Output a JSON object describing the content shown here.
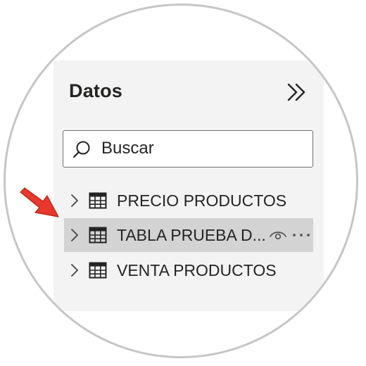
{
  "pane": {
    "title": "Datos"
  },
  "search": {
    "placeholder": "Buscar",
    "value": ""
  },
  "tables": [
    {
      "label": "PRECIO PRODUCTOS",
      "selected": false
    },
    {
      "label": "TABLA PRUEBA D...",
      "selected": true
    },
    {
      "label": "VENTA PRODUCTOS",
      "selected": false
    }
  ],
  "icons": {
    "collapse": "double-chevron-right-icon",
    "search": "search-icon",
    "expand": "chevron-right-icon",
    "table": "table-icon",
    "visibility": "eye-icon",
    "more": "more-options-icon",
    "annotation": "red-arrow-icon"
  },
  "colors": {
    "pane_background": "#f3f3f3",
    "selected_row": "#d3d3d3",
    "text": "#252423",
    "annotation_arrow": "#e8372c",
    "circle_border": "#c6c6c6"
  }
}
